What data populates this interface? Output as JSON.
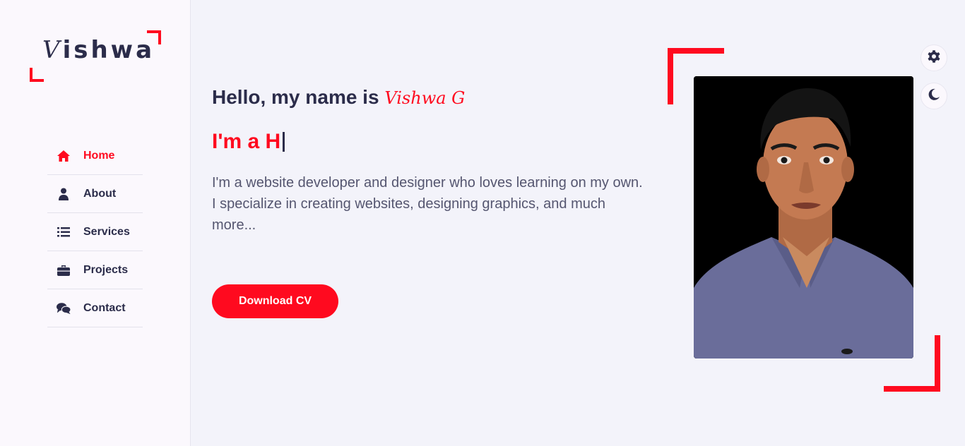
{
  "sidebar": {
    "logo": {
      "first": "V",
      "rest": "ishwa"
    },
    "nav": [
      {
        "label": "Home",
        "icon": "home-icon",
        "active": true
      },
      {
        "label": "About",
        "icon": "user-icon",
        "active": false
      },
      {
        "label": "Services",
        "icon": "list-icon",
        "active": false
      },
      {
        "label": "Projects",
        "icon": "briefcase-icon",
        "active": false
      },
      {
        "label": "Contact",
        "icon": "chat-icon",
        "active": false
      }
    ]
  },
  "hero": {
    "greeting": "Hello, my name is",
    "name": "Vishwa G",
    "typed_text": "I'm a H",
    "description": "I'm a website developer and designer who loves learning on my own. I specialize in creating websites, designing graphics, and much more...",
    "cv_button": "Download CV"
  },
  "controls": {
    "settings_icon": "gear-icon",
    "theme_icon": "moon-icon"
  },
  "colors": {
    "accent": "#ff0a1f",
    "text": "#2b2c4a",
    "background": "#f3f3fa",
    "sidebar": "#fbf8fd"
  }
}
